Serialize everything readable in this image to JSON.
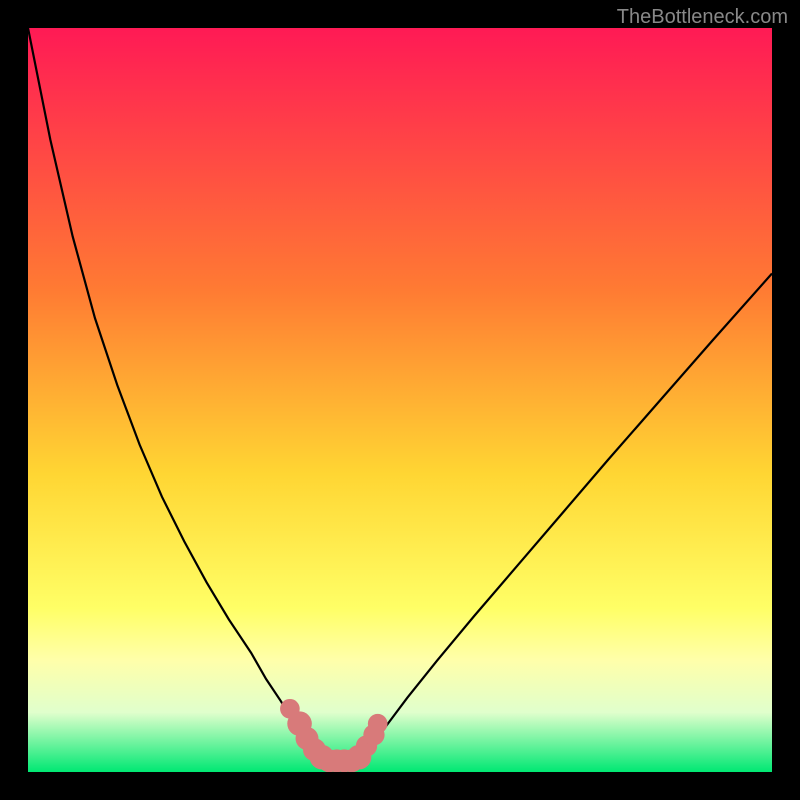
{
  "watermark": "TheBottleneck.com",
  "chart_data": {
    "type": "line",
    "title": "",
    "xlabel": "",
    "ylabel": "",
    "xlim": [
      0,
      100
    ],
    "ylim": [
      0,
      100
    ],
    "gradient_stops": [
      {
        "offset": 0,
        "color": "#ff1a55"
      },
      {
        "offset": 35,
        "color": "#ff7a33"
      },
      {
        "offset": 60,
        "color": "#ffd633"
      },
      {
        "offset": 78,
        "color": "#ffff66"
      },
      {
        "offset": 85,
        "color": "#ffffaa"
      },
      {
        "offset": 92,
        "color": "#e0ffcc"
      },
      {
        "offset": 100,
        "color": "#00e873"
      }
    ],
    "series": [
      {
        "name": "left-curve",
        "x": [
          0,
          3,
          6,
          9,
          12,
          15,
          18,
          21,
          24,
          27,
          30,
          32,
          34,
          35.5,
          37,
          38.5,
          39.5
        ],
        "values": [
          100,
          85,
          72,
          61,
          52,
          44,
          37,
          31,
          25.5,
          20.5,
          16,
          12.5,
          9.5,
          7,
          5,
          3,
          1.5
        ]
      },
      {
        "name": "right-curve",
        "x": [
          44.5,
          46,
          48,
          51,
          55,
          60,
          66,
          72,
          78,
          85,
          92,
          100
        ],
        "values": [
          1.5,
          3.5,
          6,
          10,
          15,
          21,
          28,
          35,
          42,
          50,
          58,
          67
        ]
      }
    ],
    "flat_bottom": {
      "name": "valley-floor",
      "x": [
        39.5,
        44.5
      ],
      "values": [
        1.5,
        1.5
      ]
    },
    "markers": [
      {
        "x": 35.2,
        "y": 8.5,
        "r": 1.2
      },
      {
        "x": 36.5,
        "y": 6.5,
        "r": 1.5
      },
      {
        "x": 37.5,
        "y": 4.5,
        "r": 1.4
      },
      {
        "x": 38.5,
        "y": 3.0,
        "r": 1.4
      },
      {
        "x": 39.5,
        "y": 2.0,
        "r": 1.5
      },
      {
        "x": 40.5,
        "y": 1.5,
        "r": 1.4
      },
      {
        "x": 41.5,
        "y": 1.5,
        "r": 1.4
      },
      {
        "x": 42.5,
        "y": 1.5,
        "r": 1.4
      },
      {
        "x": 43.5,
        "y": 1.5,
        "r": 1.4
      },
      {
        "x": 44.5,
        "y": 2.0,
        "r": 1.5
      },
      {
        "x": 45.5,
        "y": 3.5,
        "r": 1.3
      },
      {
        "x": 46.5,
        "y": 5.0,
        "r": 1.3
      },
      {
        "x": 47.0,
        "y": 6.5,
        "r": 1.2
      }
    ],
    "marker_color": "#d87a7a"
  }
}
